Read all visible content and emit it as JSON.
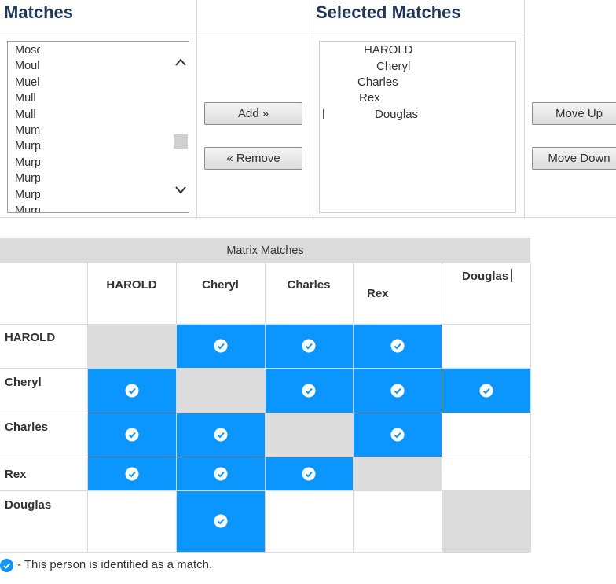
{
  "headings": {
    "matches": "Matches",
    "selected": "Selected Matches"
  },
  "matches_list": [
    "Mosc",
    "Moul",
    "Muel",
    "Mull",
    "Mull",
    "Mum",
    "Murp",
    "Murp",
    "Murp",
    "Murp",
    "Murp"
  ],
  "selected": {
    "items": [
      "HAROLD",
      "Cheryl",
      "Charles",
      "Rex",
      "Douglas"
    ]
  },
  "buttons": {
    "add": "Add »",
    "remove": "« Remove",
    "move_up": "Move Up",
    "move_down": "Move Down"
  },
  "matrix": {
    "title": "Matrix Matches",
    "people": [
      "HAROLD",
      "Cheryl",
      "Charles",
      "Rex",
      "Douglas"
    ],
    "cells": [
      [
        "self",
        "match",
        "match",
        "match",
        "none"
      ],
      [
        "match",
        "self",
        "match",
        "match",
        "match"
      ],
      [
        "match",
        "match",
        "self",
        "match",
        "none"
      ],
      [
        "match",
        "match",
        "match",
        "self",
        "none"
      ],
      [
        "none",
        "match",
        "none",
        "none",
        "self"
      ]
    ]
  },
  "legend": {
    "text": "- This person is identified as a match."
  },
  "colors": {
    "match": "#0a95ff",
    "self": "#dcdcdc",
    "heading": "#1f3857"
  }
}
